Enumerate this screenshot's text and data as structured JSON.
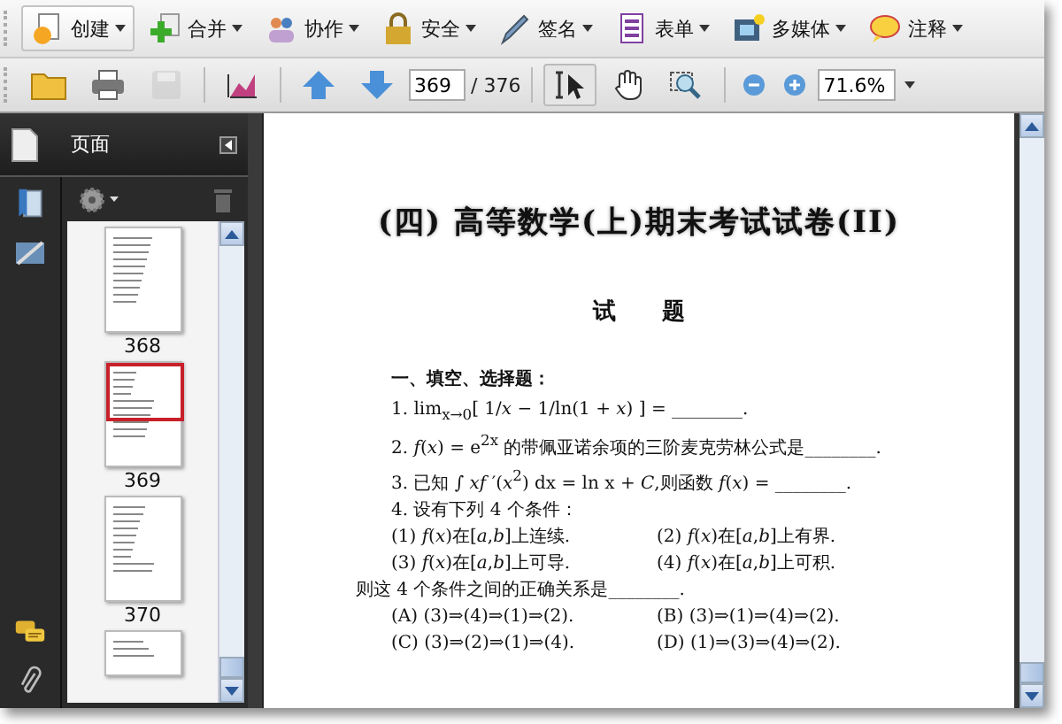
{
  "toolbar": [
    {
      "kind": "create",
      "label": "创建",
      "selected": true
    },
    {
      "kind": "combine",
      "label": "合并",
      "selected": false
    },
    {
      "kind": "collaborate",
      "label": "协作",
      "selected": false
    },
    {
      "kind": "secure",
      "label": "安全",
      "selected": false
    },
    {
      "kind": "sign",
      "label": "签名",
      "selected": false
    },
    {
      "kind": "forms",
      "label": "表单",
      "selected": false
    },
    {
      "kind": "multimedia",
      "label": "多媒体",
      "selected": false
    },
    {
      "kind": "comment",
      "label": "注释",
      "selected": false
    }
  ],
  "nav_toolbar": {
    "page": "369",
    "total": "/ 376",
    "zoom": "71.6%",
    "tools": [
      {
        "kind": "select",
        "selected": true
      },
      {
        "kind": "hand",
        "selected": false
      },
      {
        "kind": "marquee",
        "selected": false
      }
    ]
  },
  "pages_panel": {
    "title": "页面",
    "thumbnails": [
      {
        "label": "368",
        "selected": false
      },
      {
        "label": "369",
        "selected": true
      },
      {
        "label": "370",
        "selected": false
      }
    ]
  },
  "document": {
    "title": "(四) 高等数学(上)期末考试试卷(II)",
    "heading": "试　　题",
    "section": "一、填空、选择题：",
    "lines": [
      {
        "kind": "item",
        "text": "1. lim$_{x→0}$[ 1/*x* − 1/ln(1 + *x*) ] = ________."
      },
      {
        "kind": "item",
        "text": "2. *f*(*x*) = e$^{2x}$ 的带佩亚诺余项的三阶麦克劳林公式是________."
      },
      {
        "kind": "item",
        "text": "3. 已知 ∫ *xf* ′(*x*$^{2}$) dx = ln x + *C*,则函数 *f*(*x*) = ________."
      },
      {
        "kind": "item",
        "text": "4. 设有下列 4 个条件："
      },
      {
        "kind": "pair",
        "left": "(1) *f*(*x*)在[*a*,*b*]上连续.",
        "right": "(2) *f*(*x*)在[*a*,*b*]上有界."
      },
      {
        "kind": "pair",
        "left": "(3) *f*(*x*)在[*a*,*b*]上可导.",
        "right": "(4) *f*(*x*)在[*a*,*b*]上可积."
      },
      {
        "kind": "outdent",
        "text": "则这 4 个条件之间的正确关系是________."
      },
      {
        "kind": "pair",
        "left": "(A) (3)⇒(4)⇒(1)⇒(2).",
        "right": "(B) (3)⇒(1)⇒(4)⇒(2)."
      },
      {
        "kind": "pair",
        "left": "(C) (3)⇒(2)⇒(1)⇒(4).",
        "right": "(D) (1)⇒(3)⇒(4)⇒(2)."
      }
    ]
  }
}
